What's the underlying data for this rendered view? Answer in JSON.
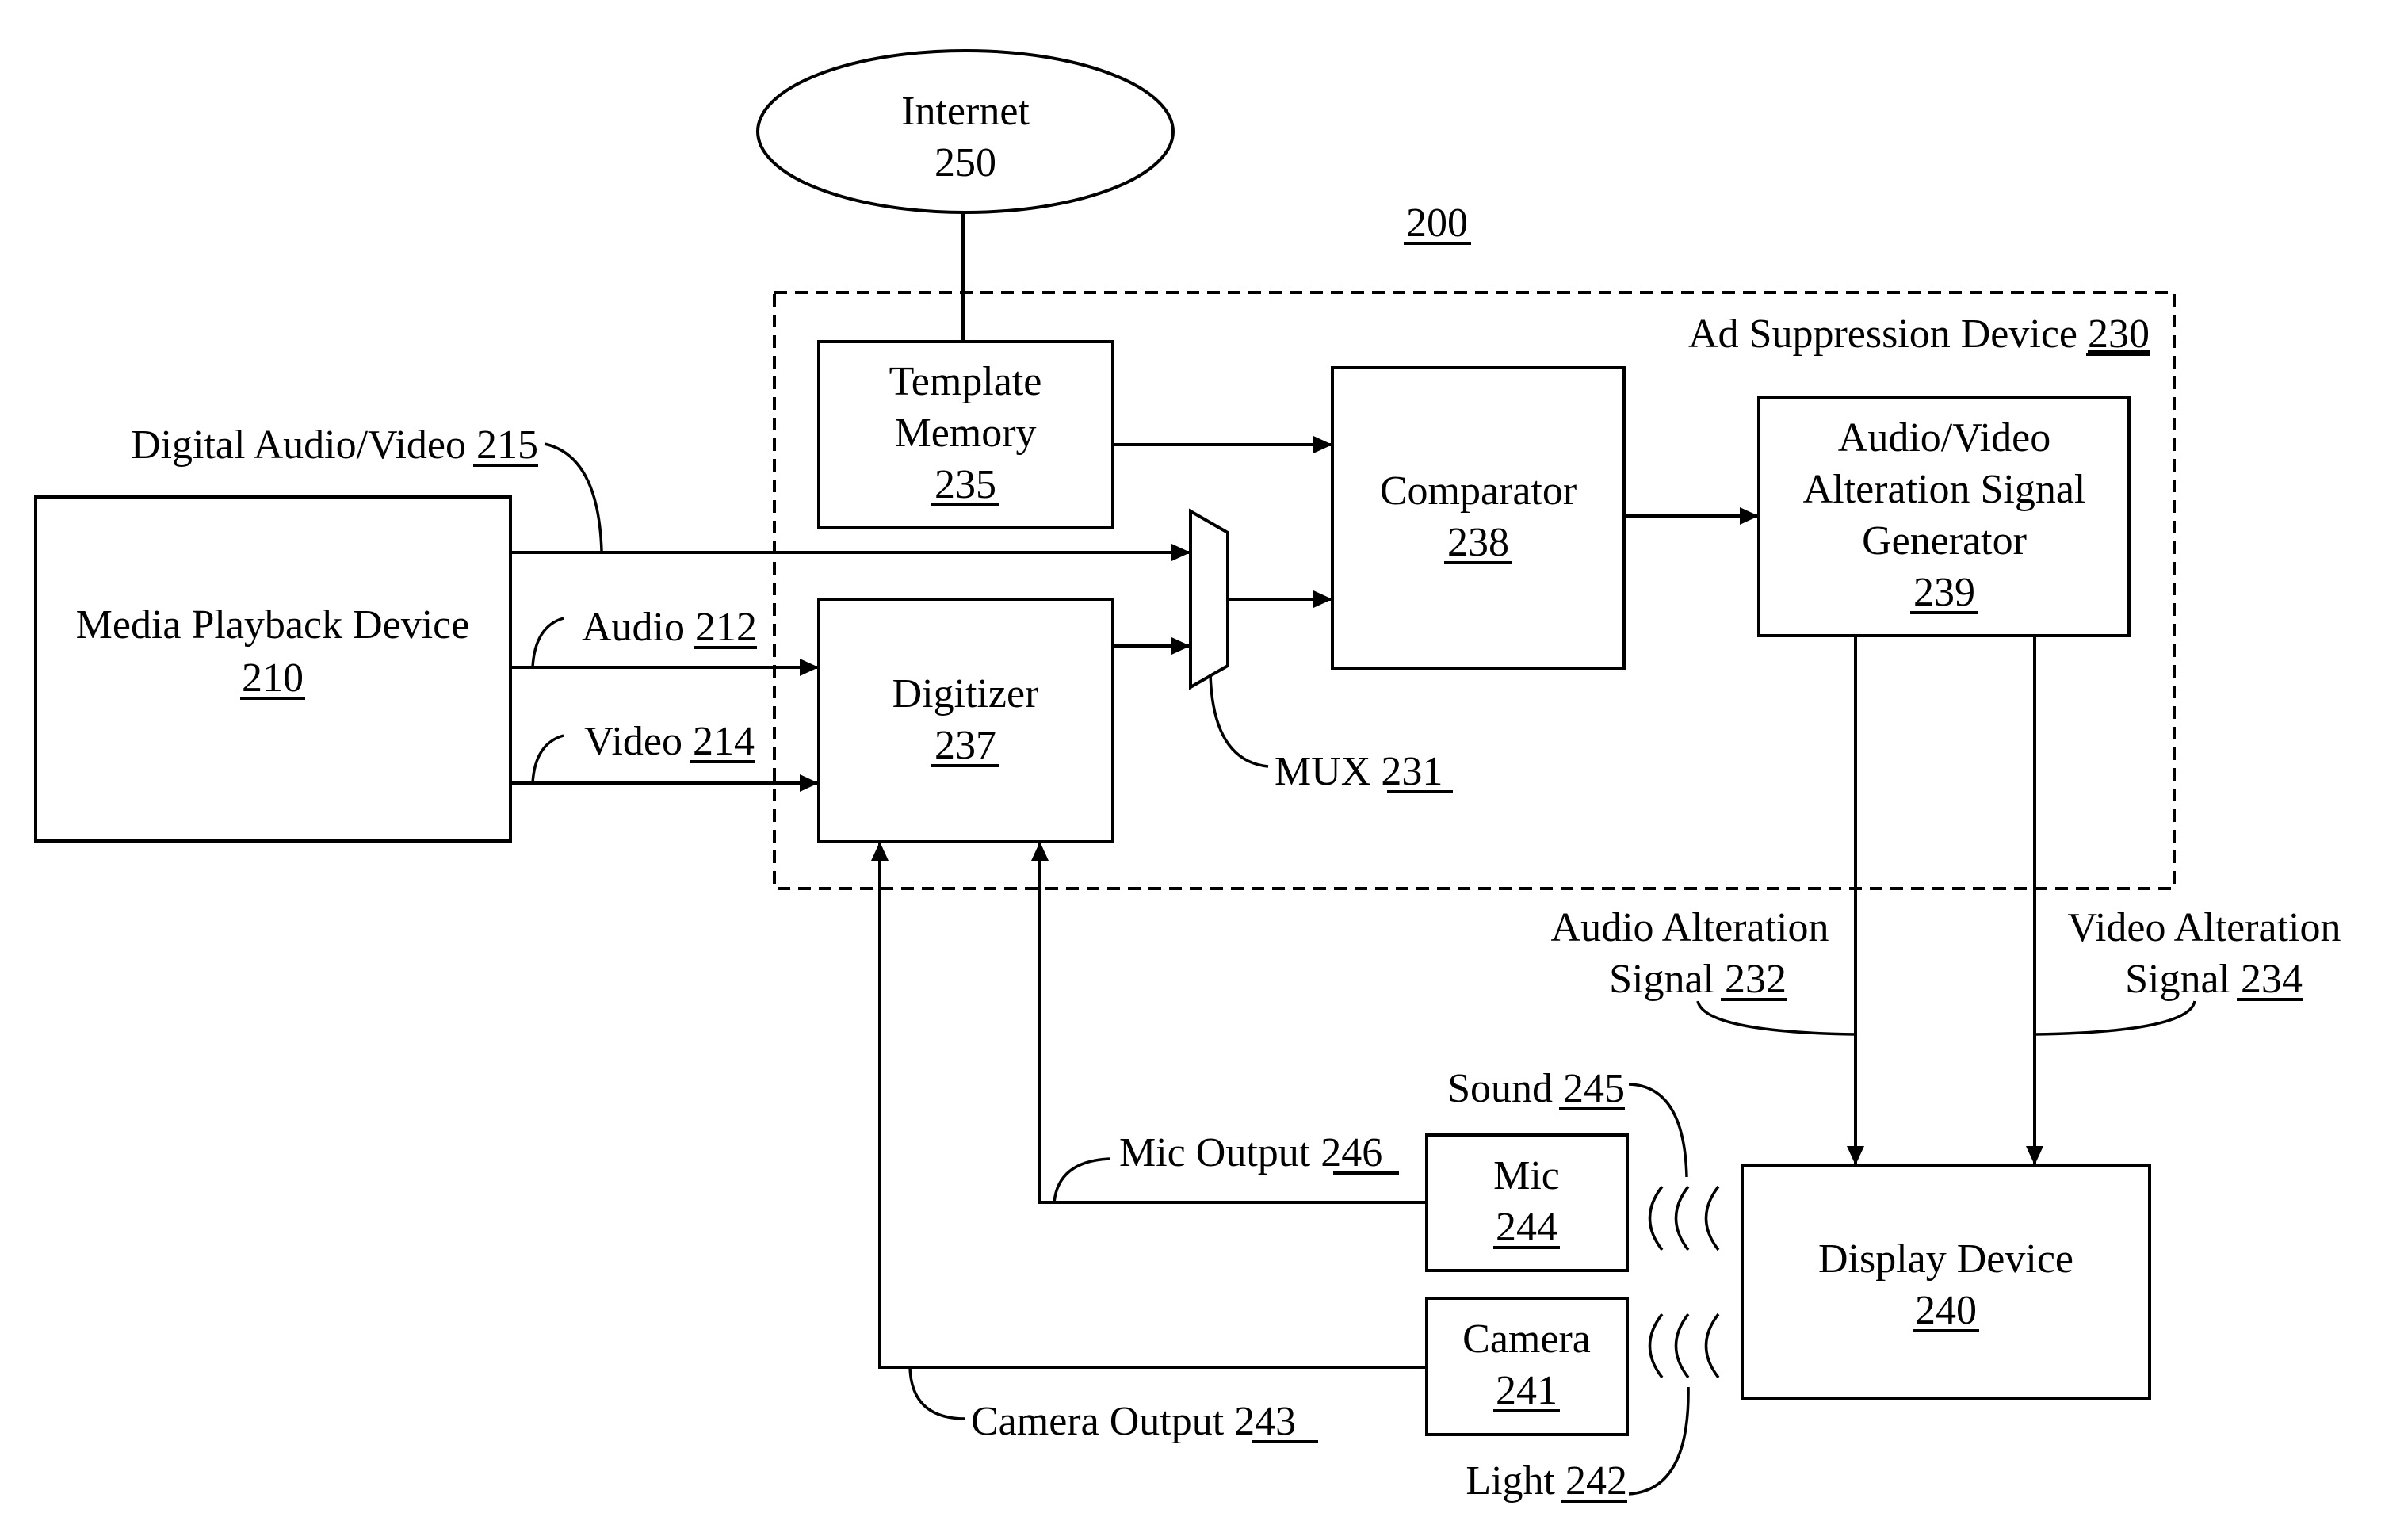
{
  "figure": {
    "number": "200",
    "ink_color": "#000000",
    "background": "#ffffff"
  },
  "nodes": {
    "internet": {
      "label": "Internet",
      "ref": "250",
      "shape": "ellipse"
    },
    "media_playback": {
      "label": "Media Playback Device",
      "ref": "210"
    },
    "ad_suppression": {
      "label": "Ad Suppression Device",
      "ref": "230",
      "style": "dashed-container"
    },
    "template_memory": {
      "lines": [
        "Template",
        "Memory"
      ],
      "ref": "235"
    },
    "digitizer": {
      "label": "Digitizer",
      "ref": "237"
    },
    "comparator": {
      "label": "Comparator",
      "ref": "238"
    },
    "av_generator": {
      "lines": [
        "Audio/Video",
        "Alteration Signal",
        "Generator"
      ],
      "ref": "239"
    },
    "mux": {
      "label": "MUX",
      "ref": "231",
      "shape": "trapezoid"
    },
    "display": {
      "label": "Display Device",
      "ref": "240"
    },
    "mic": {
      "label": "Mic",
      "ref": "244"
    },
    "camera": {
      "label": "Camera",
      "ref": "241"
    }
  },
  "signals": {
    "digital_av": {
      "label": "Digital Audio/Video",
      "ref": "215"
    },
    "audio": {
      "label": "Audio",
      "ref": "212"
    },
    "video": {
      "label": "Video",
      "ref": "214"
    },
    "audio_alteration": {
      "lines": [
        "Audio Alteration",
        "Signal"
      ],
      "ref": "232"
    },
    "video_alteration": {
      "lines": [
        "Video Alteration",
        "Signal"
      ],
      "ref": "234"
    },
    "sound": {
      "label": "Sound",
      "ref": "245"
    },
    "light": {
      "label": "Light",
      "ref": "242"
    },
    "mic_output": {
      "label": "Mic Output",
      "ref": "246"
    },
    "camera_output": {
      "label": "Camera Output",
      "ref": "243"
    }
  },
  "edges": [
    {
      "from": "internet",
      "to": "template_memory",
      "arrow": false
    },
    {
      "from": "template_memory",
      "to": "comparator",
      "arrow": true
    },
    {
      "from": "media_playback",
      "to": "mux",
      "signal": "digital_av",
      "arrow": true
    },
    {
      "from": "media_playback",
      "to": "digitizer",
      "signal": "audio",
      "arrow": true
    },
    {
      "from": "media_playback",
      "to": "digitizer",
      "signal": "video",
      "arrow": true
    },
    {
      "from": "digitizer",
      "to": "mux",
      "arrow": true
    },
    {
      "from": "mux",
      "to": "comparator",
      "arrow": true
    },
    {
      "from": "comparator",
      "to": "av_generator",
      "arrow": true
    },
    {
      "from": "av_generator",
      "to": "display",
      "signal": "audio_alteration",
      "arrow": true
    },
    {
      "from": "av_generator",
      "to": "display",
      "signal": "video_alteration",
      "arrow": true
    },
    {
      "from": "display",
      "to": "mic",
      "signal": "sound",
      "arrow": false
    },
    {
      "from": "display",
      "to": "camera",
      "signal": "light",
      "arrow": false
    },
    {
      "from": "mic",
      "to": "digitizer",
      "signal": "mic_output",
      "arrow": true
    },
    {
      "from": "camera",
      "to": "digitizer",
      "signal": "camera_output",
      "arrow": true
    }
  ]
}
